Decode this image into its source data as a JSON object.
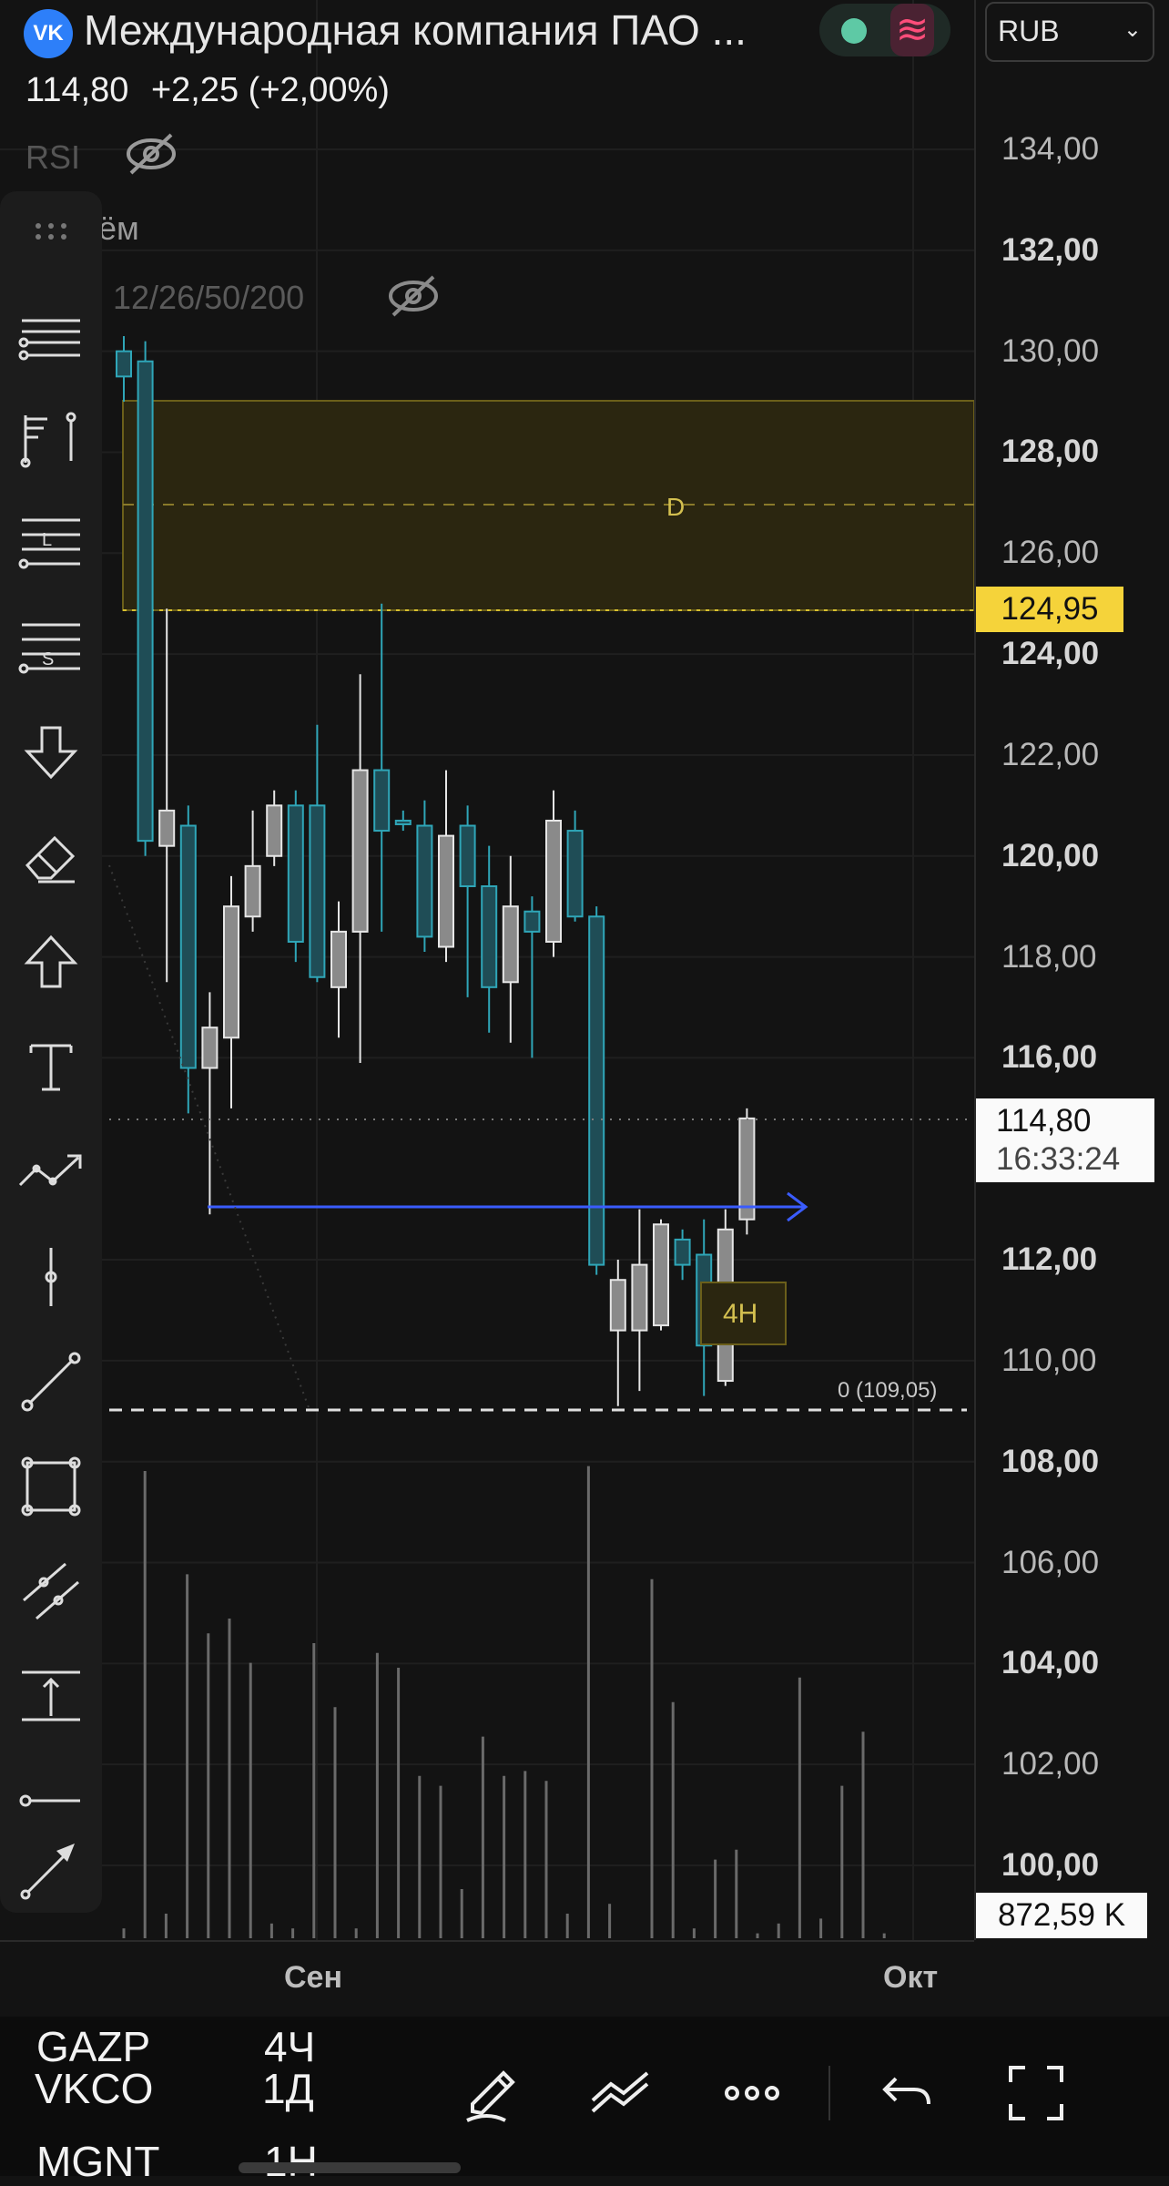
{
  "header": {
    "title": "Международная компания ПАО ...",
    "logo_text": "VK",
    "price": "114,80",
    "change": "+2,25 (+2,00%)",
    "currency": "RUB"
  },
  "indicators": {
    "rsi_label": "RSI",
    "volume_label": "ём",
    "ma_label": "12/26/50/200"
  },
  "chart_data": {
    "type": "candlestick",
    "y_axis_labels": [
      "134,00",
      "132,00",
      "130,00",
      "128,00",
      "126,00",
      "124,00",
      "122,00",
      "120,00",
      "118,00",
      "116,00",
      "112,00",
      "110,00",
      "108,00",
      "106,00",
      "104,00",
      "102,00",
      "100,00"
    ],
    "ylim": [
      99.9,
      135.1
    ],
    "x_axis_labels": [
      "Сен",
      "Окт"
    ],
    "candles": [
      {
        "o": 129.5,
        "h": 130.3,
        "l": 129.0,
        "c": 130.0,
        "dir": "down"
      },
      {
        "o": 129.8,
        "h": 130.2,
        "l": 120.0,
        "c": 120.3,
        "dir": "down"
      },
      {
        "o": 120.2,
        "h": 124.9,
        "l": 117.5,
        "c": 120.9,
        "dir": "up"
      },
      {
        "o": 120.6,
        "h": 121.0,
        "l": 114.9,
        "c": 115.8,
        "dir": "down"
      },
      {
        "o": 115.8,
        "h": 117.3,
        "l": 112.9,
        "c": 116.6,
        "dir": "up"
      },
      {
        "o": 116.4,
        "h": 119.6,
        "l": 115.0,
        "c": 119.0,
        "dir": "up"
      },
      {
        "o": 118.8,
        "h": 120.9,
        "l": 118.5,
        "c": 119.8,
        "dir": "up"
      },
      {
        "o": 120.0,
        "h": 121.3,
        "l": 119.8,
        "c": 121.0,
        "dir": "up"
      },
      {
        "o": 121.0,
        "h": 121.3,
        "l": 117.9,
        "c": 118.3,
        "dir": "down"
      },
      {
        "o": 121.0,
        "h": 122.6,
        "l": 117.5,
        "c": 117.6,
        "dir": "down"
      },
      {
        "o": 117.4,
        "h": 119.1,
        "l": 116.4,
        "c": 118.5,
        "dir": "up"
      },
      {
        "o": 118.5,
        "h": 123.6,
        "l": 115.9,
        "c": 121.7,
        "dir": "up"
      },
      {
        "o": 121.7,
        "h": 125.0,
        "l": 118.5,
        "c": 120.5,
        "dir": "down"
      },
      {
        "o": 120.7,
        "h": 120.9,
        "l": 120.5,
        "c": 120.7,
        "dir": "down"
      },
      {
        "o": 120.6,
        "h": 121.1,
        "l": 118.1,
        "c": 118.4,
        "dir": "down"
      },
      {
        "o": 118.2,
        "h": 121.7,
        "l": 117.9,
        "c": 120.4,
        "dir": "up"
      },
      {
        "o": 120.6,
        "h": 121.0,
        "l": 117.2,
        "c": 119.4,
        "dir": "down"
      },
      {
        "o": 119.4,
        "h": 120.2,
        "l": 116.5,
        "c": 117.4,
        "dir": "down"
      },
      {
        "o": 117.5,
        "h": 120.0,
        "l": 116.3,
        "c": 119.0,
        "dir": "up"
      },
      {
        "o": 118.9,
        "h": 119.2,
        "l": 116.0,
        "c": 118.5,
        "dir": "down"
      },
      {
        "o": 118.3,
        "h": 121.3,
        "l": 118.0,
        "c": 120.7,
        "dir": "up"
      },
      {
        "o": 120.5,
        "h": 120.9,
        "l": 118.7,
        "c": 118.8,
        "dir": "down"
      },
      {
        "o": 118.8,
        "h": 119.0,
        "l": 111.7,
        "c": 111.9,
        "dir": "down"
      },
      {
        "o": 110.6,
        "h": 112.0,
        "l": 109.1,
        "c": 111.6,
        "dir": "up"
      },
      {
        "o": 110.6,
        "h": 113.0,
        "l": 109.4,
        "c": 111.9,
        "dir": "up"
      },
      {
        "o": 110.7,
        "h": 112.8,
        "l": 110.6,
        "c": 112.7,
        "dir": "up"
      },
      {
        "o": 112.4,
        "h": 112.6,
        "l": 111.6,
        "c": 111.9,
        "dir": "down"
      },
      {
        "o": 112.1,
        "h": 112.8,
        "l": 109.3,
        "c": 110.3,
        "dir": "down"
      },
      {
        "o": 109.6,
        "h": 113.0,
        "l": 109.5,
        "c": 112.6,
        "dir": "up"
      },
      {
        "o": 112.8,
        "h": 115.0,
        "l": 112.5,
        "c": 114.8,
        "dir": "up"
      }
    ],
    "volumes": [
      0.02,
      0.95,
      0.05,
      0.74,
      0.62,
      0.65,
      0.56,
      0.03,
      0.02,
      0.6,
      0.47,
      0.02,
      0.58,
      0.55,
      0.33,
      0.31,
      0.1,
      0.41,
      0.33,
      0.34,
      0.32,
      0.05,
      0.96,
      0.07,
      0.0,
      0.73,
      0.48,
      0.02,
      0.16,
      0.18,
      0.01,
      0.03,
      0.53,
      0.04,
      0.31,
      0.42,
      0.01
    ]
  },
  "annotations": {
    "zone_label": "D",
    "zone_price": "124,95",
    "zone_top": 129.0,
    "zone_bottom": 124.95,
    "zone_mid": 127.0,
    "support_label": "0 (109,05)",
    "support_price": 109.05,
    "blue_line_price": 112.8,
    "box_label": "4H",
    "last_price": "114,80",
    "countdown": "16:33:24",
    "volume_value": "872,59 K",
    "colors": {
      "up": "#8a8a8a",
      "down": "#2fa6b8",
      "zone": "#6b5f1a",
      "blue": "#3a5cff",
      "last": "#fafafa"
    }
  },
  "bottom_bar": {
    "ticker": "VKCO",
    "interval": "1Д",
    "ghost_1": "GAZP",
    "ghost_1_int": "4Ч",
    "ghost_2": "MGNT",
    "ghost_2_int": "1Н"
  },
  "toolbar_icons": [
    "drag-handle-icon",
    "lines-icon",
    "flag-icon",
    "long-position-icon",
    "short-position-icon",
    "arrow-down-icon",
    "eraser-icon",
    "arrow-up-icon",
    "text-icon",
    "trend-icon",
    "cross-icon",
    "line-icon",
    "rectangle-icon",
    "parallel-channel-icon",
    "range-icon",
    "horizontal-ray-icon",
    "arrow-icon"
  ]
}
